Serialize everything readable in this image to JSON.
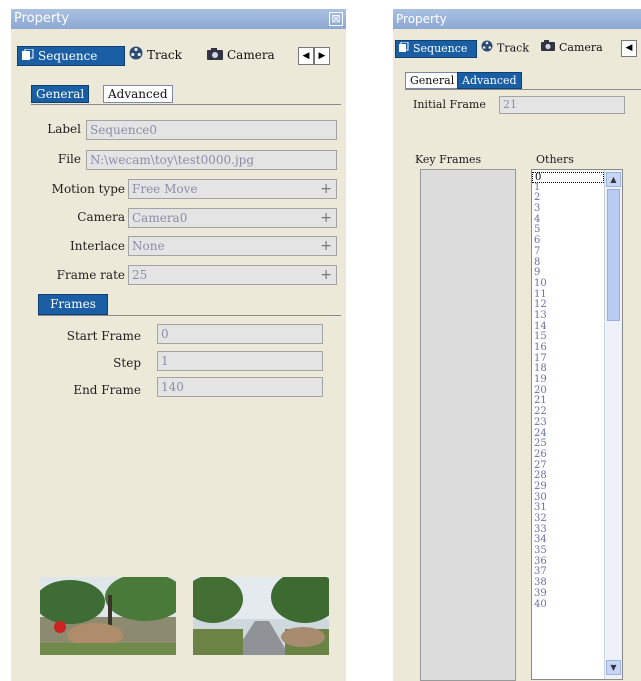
{
  "left_panel": {
    "title": "Property",
    "close_glyph": "⊠",
    "tabs": [
      {
        "label": "Sequence",
        "icon": "sequence-icon"
      },
      {
        "label": "Track",
        "icon": "film-reel-icon"
      },
      {
        "label": "Camera",
        "icon": "camera-icon"
      }
    ],
    "nav_prev": "◀",
    "nav_next": "▶",
    "subtabs": [
      "General",
      "Advanced"
    ],
    "fields": {
      "label": {
        "label": "Label",
        "value": "Sequence0"
      },
      "file": {
        "label": "File",
        "value": "N:\\wecam\\toy\\test0000.jpg"
      },
      "motion_type": {
        "label": "Motion type",
        "value": "Free Move"
      },
      "camera": {
        "label": "Camera",
        "value": "Camera0"
      },
      "interlace": {
        "label": "Interlace",
        "value": "None"
      },
      "frame_rate": {
        "label": "Frame rate",
        "value": "25"
      }
    },
    "plus_glyph": "+",
    "frames_tab": "Frames",
    "frames": {
      "start": {
        "label": "Start Frame",
        "value": "0"
      },
      "step": {
        "label": "Step",
        "value": "1"
      },
      "end": {
        "label": "End Frame",
        "value": "140"
      }
    }
  },
  "right_panel": {
    "title": "Property",
    "tabs": [
      {
        "label": "Sequence",
        "icon": "sequence-icon"
      },
      {
        "label": "Track",
        "icon": "film-reel-icon"
      },
      {
        "label": "Camera",
        "icon": "camera-icon"
      }
    ],
    "nav_prev": "◀",
    "subtabs": [
      "General",
      "Advanced"
    ],
    "initial_frame": {
      "label": "Initial Frame",
      "value": "21"
    },
    "key_frames_label": "Key Frames",
    "others_label": "Others",
    "others_items": [
      "0",
      "1",
      "2",
      "3",
      "4",
      "5",
      "6",
      "7",
      "8",
      "9",
      "10",
      "11",
      "12",
      "13",
      "14",
      "15",
      "16",
      "17",
      "18",
      "19",
      "20",
      "21",
      "22",
      "23",
      "24",
      "25",
      "26",
      "27",
      "28",
      "29",
      "30",
      "31",
      "32",
      "33",
      "34",
      "35",
      "36",
      "37",
      "38",
      "39",
      "40"
    ],
    "selected_item": "0",
    "scroll_up": "▲",
    "scroll_down": "▼"
  },
  "colors": {
    "panel_bg": "#ece9d8",
    "title_bar": "#8da8d4",
    "active_tab": "#1a5fa3",
    "field_bg": "#e4e4e4",
    "field_text": "#8a8ea8"
  }
}
